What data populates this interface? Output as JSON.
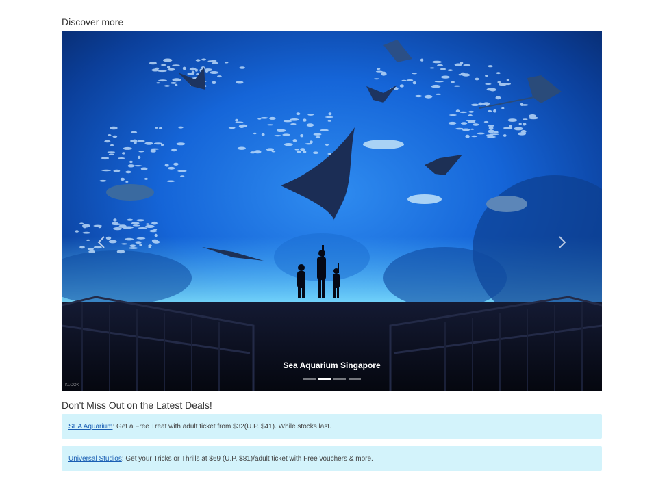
{
  "discover": {
    "title": "Discover more"
  },
  "carousel": {
    "caption": "Sea Aquarium Singapore",
    "slide_count": 4,
    "active_slide": 2,
    "watermark": "KLOOK",
    "prev_icon": "chevron-left-icon",
    "next_icon": "chevron-right-icon"
  },
  "deals": {
    "title": "Don't Miss Out on the Latest Deals!",
    "items": [
      {
        "link_text": "SEA Aquarium",
        "text": ": Get a Free Treat with adult ticket from $32(U.P. $41). While stocks last."
      },
      {
        "link_text": "Universal Studios",
        "text": ": Get your Tricks or Thrills at $69 (U.P. $81)/adult ticket with Free vouchers & more."
      }
    ]
  },
  "colors": {
    "deal_background": "#d3f3fb",
    "link": "#1a5fb4"
  }
}
